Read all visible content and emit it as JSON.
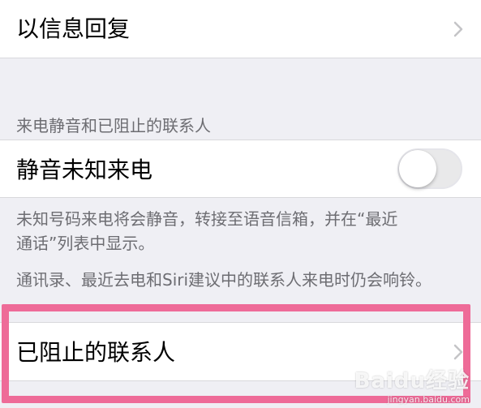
{
  "reply_row": {
    "label": "以信息回复",
    "icon": "chevron-right-icon"
  },
  "section": {
    "header": "来电静音和已阻止的联系人"
  },
  "silence_row": {
    "label": "静音未知来电",
    "toggle_on": false
  },
  "footer": {
    "line1": "未知号码来电将会静音，转接至语音信箱，并在“最近",
    "line2": "通话”列表中显示。",
    "line3": "通讯录、最近去电和Siri建议中的联系人来电时仍会响铃。"
  },
  "blocked_row": {
    "label": "已阻止的联系人",
    "icon": "chevron-right-icon"
  },
  "highlight_color": "#ee6b98",
  "watermark": {
    "main": "Baidu经验",
    "sub": "jingyan.baidu.com"
  }
}
